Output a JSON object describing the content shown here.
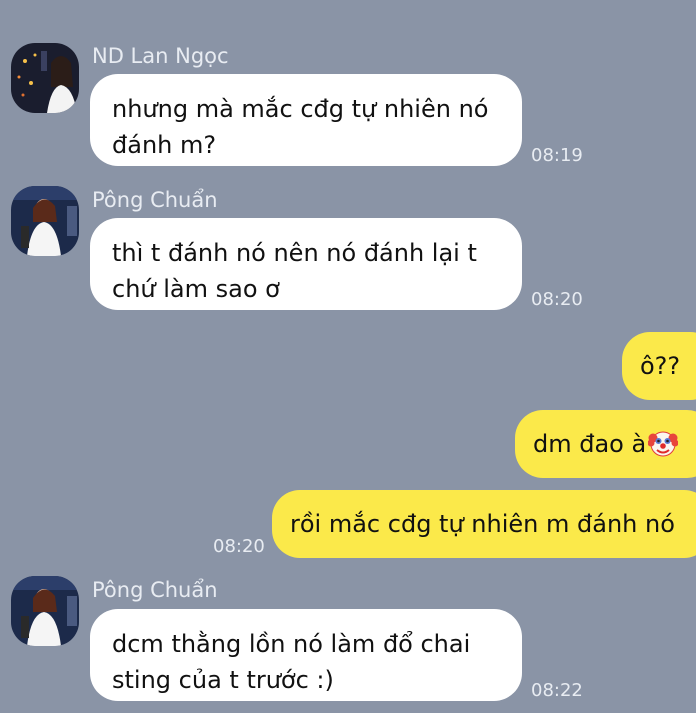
{
  "messages": [
    {
      "sender": "ND Lan Ngọc",
      "lines": [
        "nhưng mà mắc cđg tự nhiên nó",
        "đánh m?"
      ],
      "time": "08:19"
    },
    {
      "sender": "Pông Chuẩn",
      "lines": [
        "thì t đánh nó nên nó đánh lại t",
        "chứ làm sao ơ"
      ],
      "time": "08:20"
    },
    {
      "text": "ô??"
    },
    {
      "text": "dm đao à",
      "emoji": "clown-face-icon"
    },
    {
      "text": "rồi mắc cđg tự nhiên m đánh nó",
      "time": "08:20"
    },
    {
      "sender": "Pông Chuẩn",
      "lines": [
        "dcm thằng lồn nó làm đổ chai",
        "sting của t trước :)"
      ],
      "time": "08:22"
    }
  ],
  "colors": {
    "background": "#8a94a6",
    "incoming_bubble": "#ffffff",
    "outgoing_bubble": "#fbe94a",
    "meta_text": "#e8ecf2"
  }
}
